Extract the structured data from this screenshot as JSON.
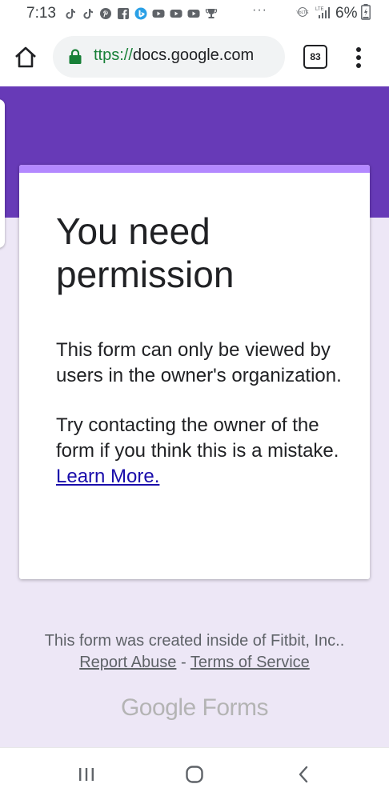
{
  "status_bar": {
    "time": "7:13",
    "battery_percent": "6%",
    "network": "LTE",
    "volte": "VoLTE",
    "more_notifications": "···"
  },
  "toolbar": {
    "url_scheme": "ttps://",
    "url_host": "docs.google.com",
    "tab_count": "83"
  },
  "card": {
    "title": "You need permission",
    "message": "This form can only be viewed by users in the owner's organization.",
    "hint": "Try contacting the owner of the form if you think this is a mistake.",
    "learn_more": "Learn More."
  },
  "footer": {
    "created_text": "This form was created inside of Fitbit, Inc..",
    "report_abuse": "Report Abuse",
    "separator": "-",
    "terms": "Terms of Service"
  },
  "branding": {
    "google": "Google",
    "forms": "Forms"
  },
  "colors": {
    "header_purple": "#673ab7",
    "card_accent": "#b388ff",
    "page_background": "#ede7f6",
    "link_blue": "#1a0dab",
    "secure_green": "#188038"
  }
}
